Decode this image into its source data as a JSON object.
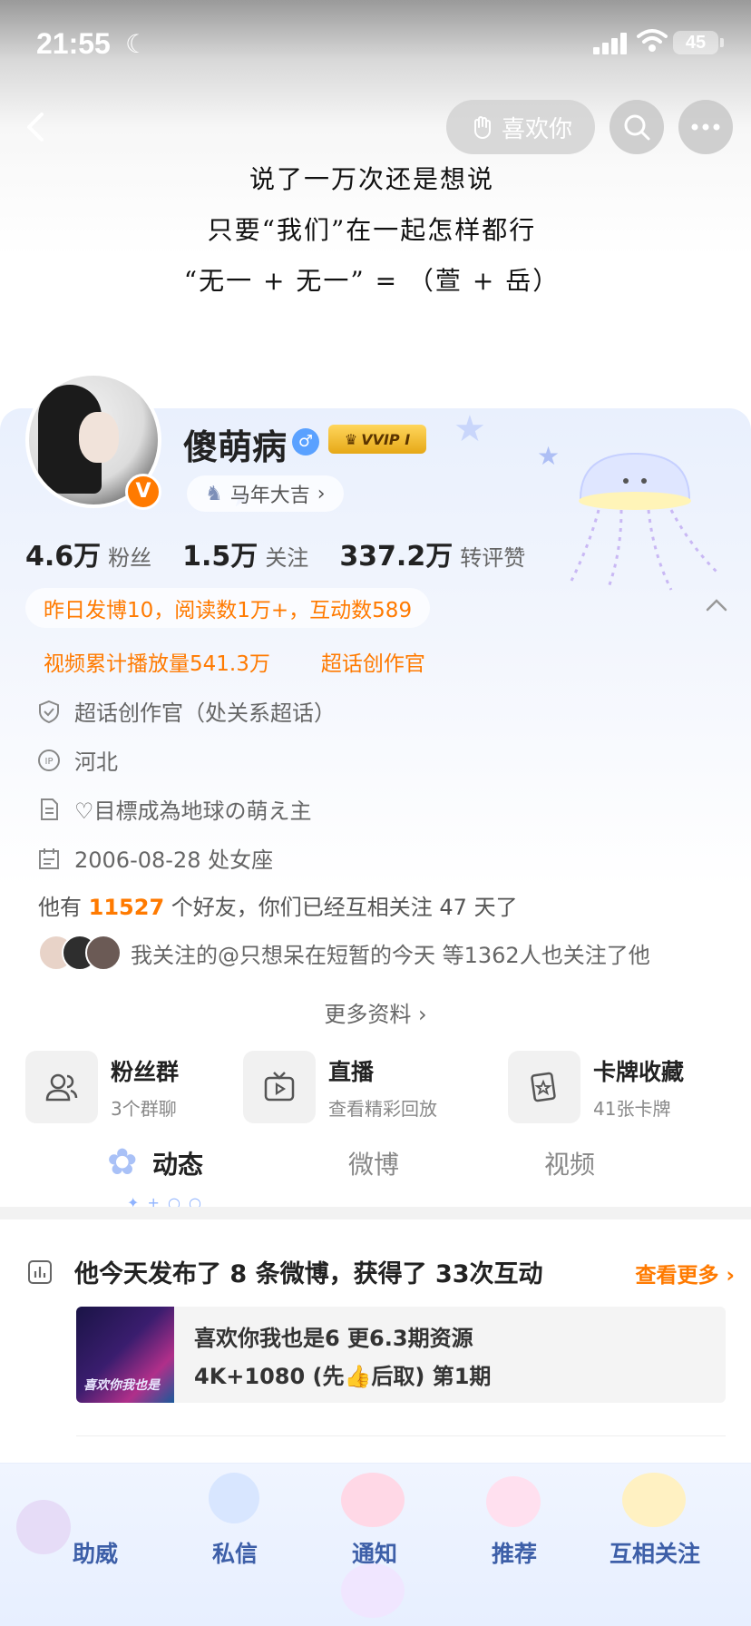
{
  "status_bar": {
    "time": "21:55",
    "battery": "45"
  },
  "header": {
    "like_label": "喜欢你"
  },
  "cover_text": [
    "说了一万次还是想说",
    "只要“我们”在一起怎样都行",
    "“无一 + 无一” = （萱 + 岳）"
  ],
  "profile": {
    "name": "傻萌病",
    "vip_label": "VVIP I",
    "verified_badge": "V",
    "tag": "马年大吉",
    "stats": [
      {
        "num": "4.6万",
        "label": "粉丝"
      },
      {
        "num": "1.5万",
        "label": "关注"
      },
      {
        "num": "337.2万",
        "label": "转评赞"
      }
    ],
    "yesterday": "昨日发博10，阅读数1万+，互动数589",
    "video_plays": "视频累计播放量541.3万",
    "super_topic": "超话创作官",
    "info": [
      {
        "icon": "shield-icon",
        "text": "超话创作官（处关系超话）"
      },
      {
        "icon": "ip-icon",
        "text": "河北"
      },
      {
        "icon": "document-icon",
        "text": "♡目標成為地球の萌え主"
      },
      {
        "icon": "calendar-icon",
        "text": "2006-08-28 处女座"
      }
    ],
    "friends_prefix": "他有",
    "friends_count": "11527",
    "friends_suffix": "个好友，你们已经互相关注 47 天了",
    "mutual_text": "我关注的@只想呆在短暂的今天 等1362人也关注了他",
    "more_info": "更多资料"
  },
  "features": [
    {
      "title": "粉丝群",
      "subtitle": "3个群聊",
      "icon": "fans-group-icon"
    },
    {
      "title": "直播",
      "subtitle": "查看精彩回放",
      "icon": "tv-icon"
    },
    {
      "title": "卡牌收藏",
      "subtitle": "41张卡牌",
      "icon": "card-icon"
    }
  ],
  "tabs": [
    "动态",
    "微博",
    "视频"
  ],
  "summary": {
    "text": "他今天发布了 8 条微博，获得了 33次互动",
    "more": "查看更多"
  },
  "media_post": {
    "line1": "喜欢你我也是6  更6.3期资源",
    "line2": "4K+1080 (先👍后取) 第1期",
    "thumb_caption": "喜欢你我也是"
  },
  "bottom_nav": [
    "助威",
    "私信",
    "通知",
    "推荐",
    "互相关注"
  ],
  "colors": {
    "accent": "#ff7a00",
    "nav_text": "#3d5fa8",
    "card_bg": "#e9f0fd"
  }
}
